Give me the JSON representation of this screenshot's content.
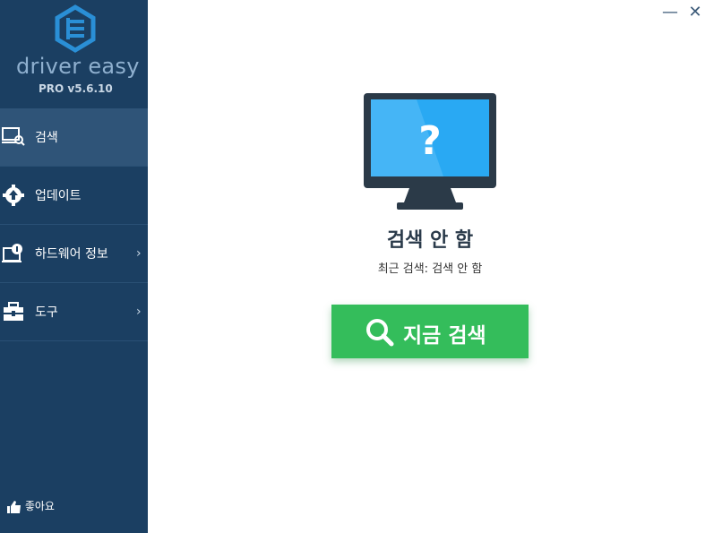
{
  "app": {
    "brand": "driver easy",
    "version": "PRO v5.6.10"
  },
  "window": {
    "minimize": "—",
    "close": "✕"
  },
  "sidebar": {
    "items": [
      {
        "label": "검색",
        "icon": "scan-icon",
        "active": true
      },
      {
        "label": "업데이트",
        "icon": "gear-upload-icon",
        "active": false
      },
      {
        "label": "하드웨어 정보",
        "icon": "hardware-info-icon",
        "active": false,
        "chevron": "›"
      },
      {
        "label": "도구",
        "icon": "toolbox-icon",
        "active": false,
        "chevron": "›"
      }
    ],
    "like_label": "좋아요"
  },
  "main": {
    "monitor_symbol": "?",
    "status_title": "검색 안 함",
    "status_sub": "최근 검색: 검색 안 함",
    "scan_button": "지금 검색"
  },
  "colors": {
    "sidebar_bg": "#1b3f62",
    "active_item": "#2f5478",
    "scan_green": "#34bd5b",
    "screen_blue": "#29a9f3"
  }
}
